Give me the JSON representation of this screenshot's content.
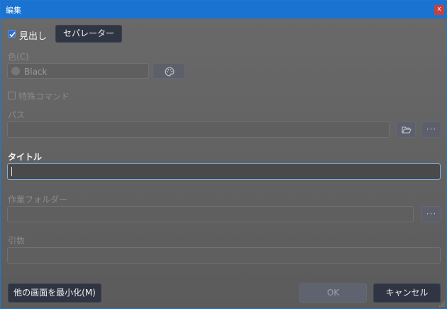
{
  "window": {
    "title": "編集",
    "close_label": "x"
  },
  "header": {
    "heading_checkbox_label": "見出し",
    "heading_checked": true,
    "separator_button": "セパレーター"
  },
  "color": {
    "label": "色(C)",
    "value": "Black",
    "palette_icon": "palette-icon"
  },
  "special_command": {
    "label": "特殊コマンド",
    "checked": false
  },
  "path": {
    "label": "パス",
    "value": "",
    "folder_icon": "folder-open-icon",
    "more_label": "···"
  },
  "title_field": {
    "label": "タイトル",
    "value": ""
  },
  "workdir": {
    "label": "作業フォルダー",
    "value": "",
    "more_label": "···"
  },
  "args": {
    "label": "引数",
    "value": ""
  },
  "footer": {
    "minimize_button": "他の画面を最小化(M)",
    "ok_button": "OK",
    "cancel_button": "キャンセル"
  },
  "colors": {
    "titlebar": "#1a73d1",
    "accent_focus": "#7cb1e6",
    "dark_button": "#2f3543",
    "close_button": "#c8403f"
  }
}
